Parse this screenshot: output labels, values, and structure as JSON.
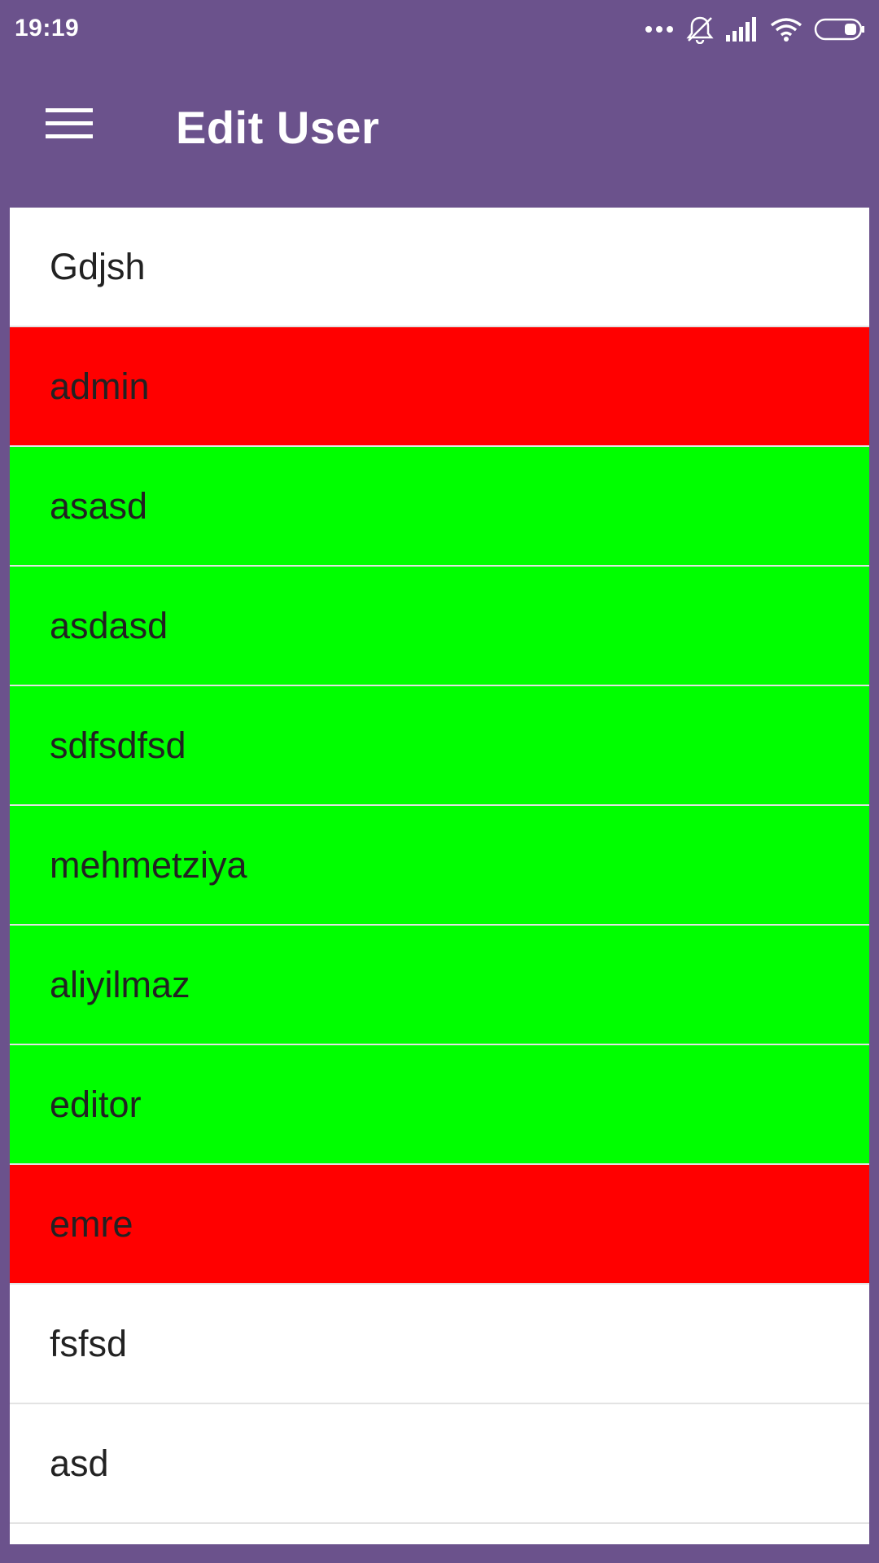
{
  "status_bar": {
    "time": "19:19",
    "icons": [
      "more-dots-icon",
      "bell-off-icon",
      "signal-icon",
      "wifi-icon",
      "battery-icon"
    ]
  },
  "app_bar": {
    "menu_icon": "hamburger-menu-icon",
    "title": "Edit User",
    "background": "#6b528c"
  },
  "colors": {
    "red": "#ff0000",
    "green": "#00ff00",
    "white": "#ffffff"
  },
  "users": [
    {
      "name": "Gdjsh",
      "color": "#ffffff"
    },
    {
      "name": "admin",
      "color": "#ff0000"
    },
    {
      "name": "asasd",
      "color": "#00ff00"
    },
    {
      "name": "asdasd",
      "color": "#00ff00"
    },
    {
      "name": "sdfsdfsd",
      "color": "#00ff00"
    },
    {
      "name": "mehmetziya",
      "color": "#00ff00"
    },
    {
      "name": "aliyilmaz",
      "color": "#00ff00"
    },
    {
      "name": "editor",
      "color": "#00ff00"
    },
    {
      "name": "emre",
      "color": "#ff0000"
    },
    {
      "name": "fsfsd",
      "color": "#ffffff"
    },
    {
      "name": "asd",
      "color": "#ffffff"
    }
  ]
}
